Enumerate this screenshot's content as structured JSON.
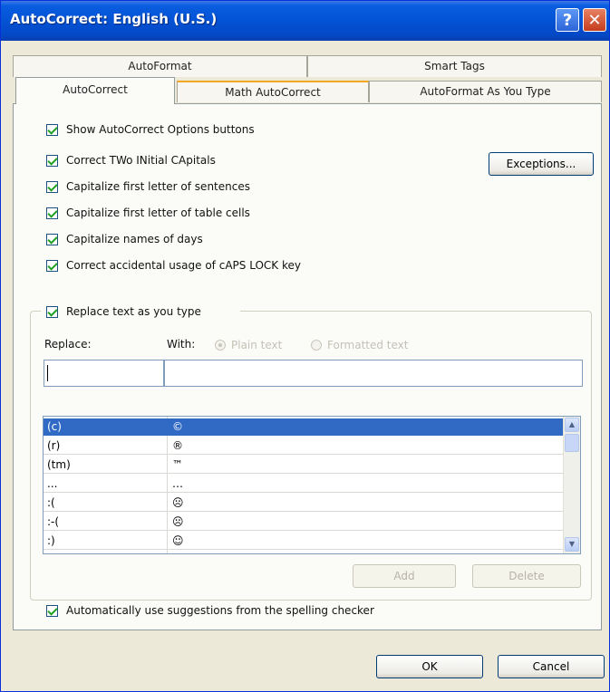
{
  "window": {
    "title": "AutoCorrect: English (U.S.)"
  },
  "titlebar": {
    "help_glyph": "?",
    "close_glyph": "✕"
  },
  "tabs": {
    "back": [
      {
        "label": "AutoFormat"
      },
      {
        "label": "Smart Tags"
      }
    ],
    "front": [
      {
        "label": "AutoCorrect"
      },
      {
        "label": "Math AutoCorrect"
      },
      {
        "label": "AutoFormat As You Type"
      }
    ]
  },
  "options": {
    "show_buttons": "Show AutoCorrect Options buttons",
    "two_initial_caps": "Correct TWo INitial CApitals",
    "first_letter_sentences": "Capitalize first letter of sentences",
    "first_letter_table_cells": "Capitalize first letter of table cells",
    "names_of_days": "Capitalize names of days",
    "caps_lock": "Correct accidental usage of cAPS LOCK key",
    "exceptions_button": "Exceptions...",
    "replace_as_you_type": "Replace text as you type",
    "use_spelling_suggestions": "Automatically use suggestions from the spelling checker"
  },
  "replace": {
    "replace_label": "Replace:",
    "with_label": "With:",
    "plain_text": "Plain text",
    "formatted_text": "Formatted text",
    "replace_value": "",
    "with_value": ""
  },
  "entries": [
    {
      "from": "(c)",
      "to": "©"
    },
    {
      "from": "(r)",
      "to": "®"
    },
    {
      "from": "(tm)",
      "to": "™"
    },
    {
      "from": "...",
      "to": "…"
    },
    {
      "from": ":(",
      "to": "☹"
    },
    {
      "from": ":-(",
      "to": "☹"
    },
    {
      "from": ":)",
      "to": "☺"
    }
  ],
  "buttons": {
    "add": "Add",
    "delete": "Delete",
    "ok": "OK",
    "cancel": "Cancel"
  },
  "colors": {
    "titlebar": "#0454d6",
    "selection": "#316ac5",
    "check": "#21a121",
    "dialog_bg": "#ece9d8"
  },
  "icons": [
    "help-icon",
    "close-icon",
    "checkmark-icon",
    "scroll-up-icon",
    "scroll-down-icon"
  ]
}
